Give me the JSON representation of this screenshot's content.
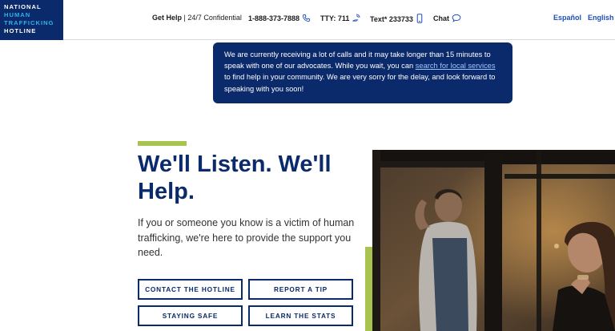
{
  "logo": {
    "line1": "NATIONAL",
    "line2": "HUMAN",
    "line3": "TRAFFICKING",
    "line4": "HOTLINE"
  },
  "header": {
    "get_help": "Get Help",
    "separator": " | ",
    "confidential": "24/7 Confidential",
    "phone": "1-888-373-7888",
    "tty": "TTY: 711",
    "text": "Text* 233733",
    "chat": "Chat",
    "lang_es": "Español",
    "lang_en": "English"
  },
  "notice": {
    "text_before": "We are currently receiving a lot of calls and it may take longer than 15 minutes to speak with one of our advocates. While you wait, you can ",
    "link": "search for local services",
    "text_after": " to find help in your community. We are very sorry for the delay, and look forward to speaking with you soon!"
  },
  "hero": {
    "headline": "We'll Listen. We'll Help.",
    "lede": "If you or someone you know is a victim of human trafficking, we're here to provide the support you need."
  },
  "buttons": {
    "contact": "CONTACT THE HOTLINE",
    "report": "REPORT A TIP",
    "safe": "STAYING SAFE",
    "stats": "LEARN THE STATS"
  },
  "colors": {
    "navy": "#0b2a6b",
    "accent_green": "#a8c34f",
    "link_blue": "#1d4fb8",
    "logo_cyan": "#33b1e8"
  },
  "icons": {
    "phone": "phone-icon",
    "tty": "tty-icon",
    "text": "mobile-phone-icon",
    "chat": "chat-bubble-icon"
  }
}
